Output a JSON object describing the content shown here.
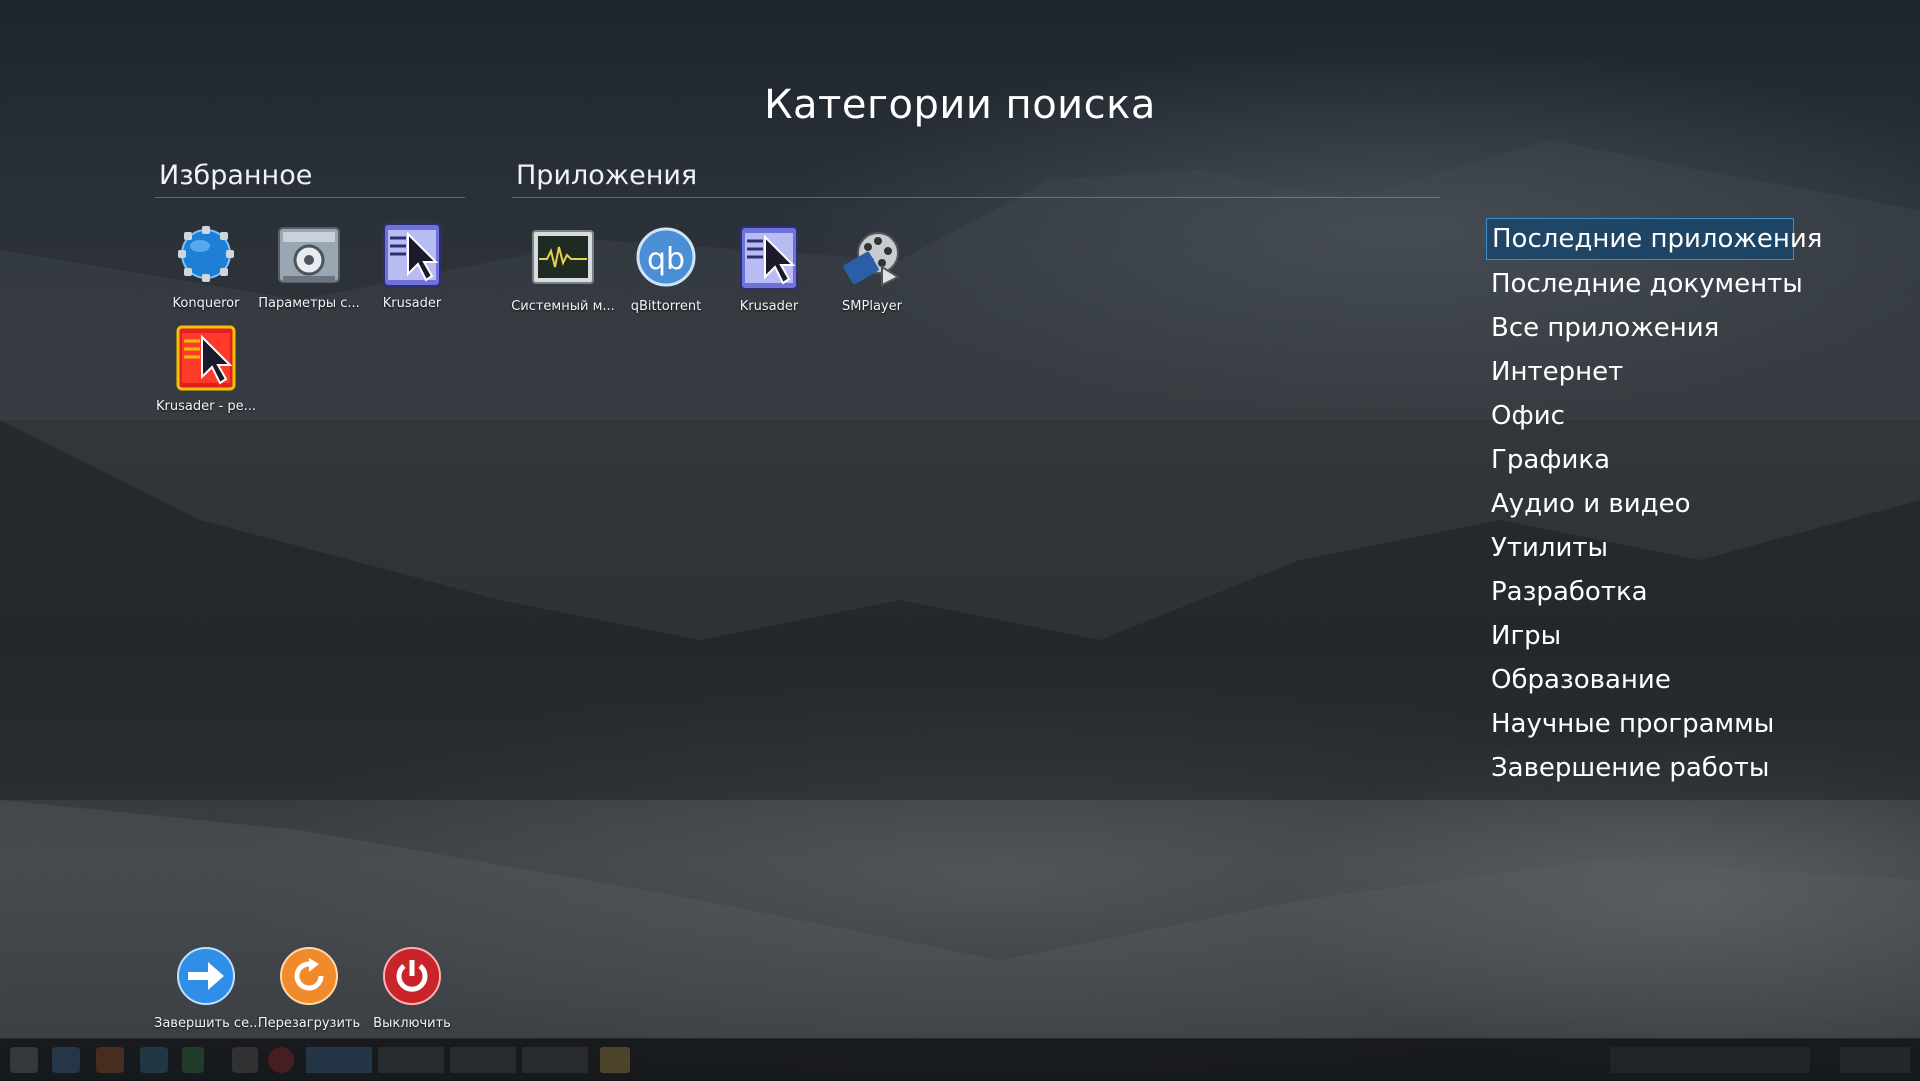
{
  "title": "Категории поиска",
  "favorites": {
    "heading": "Избранное",
    "apps": [
      {
        "label": "Konqueror",
        "icon": "globe-icon"
      },
      {
        "label": "Параметры с...",
        "icon": "settings-icon"
      },
      {
        "label": "Krusader",
        "icon": "krusader-icon"
      },
      {
        "label": "Krusader - ре...",
        "icon": "krusader-root-icon"
      }
    ]
  },
  "applications": {
    "heading": "Приложения",
    "apps": [
      {
        "label": "Системный м...",
        "icon": "system-monitor-icon"
      },
      {
        "label": "qBittorrent",
        "icon": "qbittorrent-icon"
      },
      {
        "label": "Krusader",
        "icon": "krusader-icon"
      },
      {
        "label": "SMPlayer",
        "icon": "smplayer-icon"
      }
    ]
  },
  "categories": [
    "Последние приложения",
    "Последние документы",
    "Все приложения",
    "Интернет",
    "Офис",
    "Графика",
    "Аудио и видео",
    "Утилиты",
    "Разработка",
    "Игры",
    "Образование",
    "Научные программы",
    "Завершение работы"
  ],
  "active_category_index": 0,
  "session": [
    {
      "label": "Завершить се...",
      "icon": "logout-arrow-icon"
    },
    {
      "label": "Перезагрузить",
      "icon": "restart-icon"
    },
    {
      "label": "Выключить",
      "icon": "power-icon"
    }
  ],
  "colors": {
    "active_category_bg": "#14466e",
    "active_category_border": "#3d8fcf"
  }
}
